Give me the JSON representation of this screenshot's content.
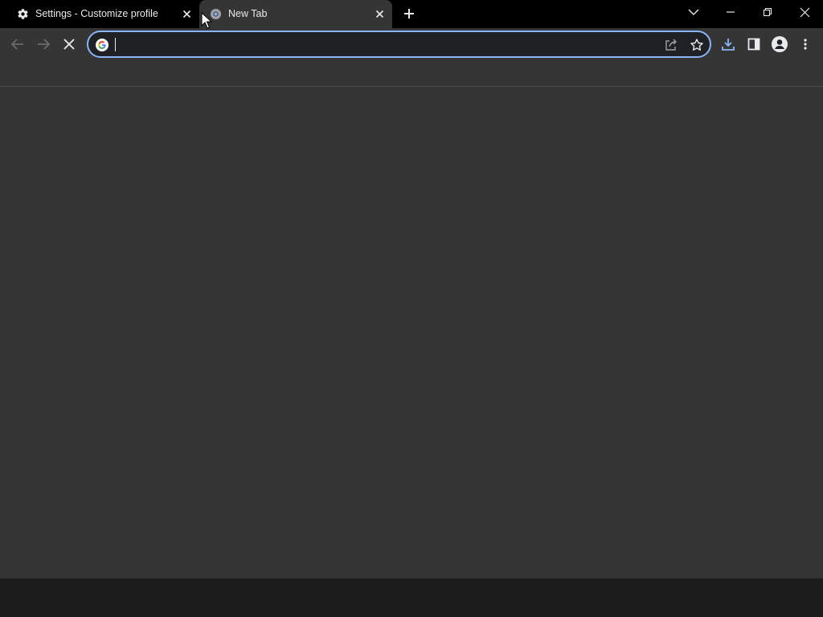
{
  "tabs": [
    {
      "title": "Settings - Customize profile",
      "icon": "gear-icon",
      "active": false
    },
    {
      "title": "New Tab",
      "icon": "chrome-icon",
      "active": true
    }
  ],
  "omnibox": {
    "value": "",
    "placeholder": ""
  },
  "colors": {
    "accent": "#8ab4f8",
    "download_accent": "#8ab4f8",
    "background": "#353535",
    "tabstrip": "#000000"
  }
}
